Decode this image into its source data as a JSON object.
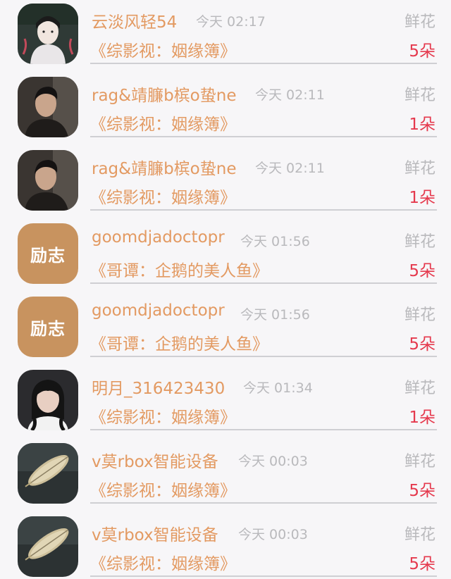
{
  "accent_colors": {
    "username": "#e39a62",
    "count": "#e5394d",
    "muted": "#b9b9bc",
    "divider": "#cfcfd3"
  },
  "records": [
    {
      "avatar": "avatar-illustrated-character-icon",
      "username": "云淡风轻54",
      "time": "今天 02:17",
      "gift_label": "鲜花",
      "book_title": "《综影视：姻缘簿》",
      "count": "5朵"
    },
    {
      "avatar": "avatar-young-man-photo-icon",
      "username": "rag&靖臁b槟o蛰ne",
      "time": "今天 02:11",
      "gift_label": "鲜花",
      "book_title": "《综影视：姻缘簿》",
      "count": "1朵"
    },
    {
      "avatar": "avatar-young-man-photo-icon",
      "username": "rag&靖臁b槟o蛰ne",
      "time": "今天 02:11",
      "gift_label": "鲜花",
      "book_title": "《综影视：姻缘簿》",
      "count": "1朵"
    },
    {
      "avatar": "avatar-lizhi-text-icon",
      "avatar_text": "励志",
      "username": "goomdjadoctopr",
      "time": "今天 01:56",
      "gift_label": "鲜花",
      "book_title": "《哥谭：企鹅的美人鱼》",
      "count": "5朵"
    },
    {
      "avatar": "avatar-lizhi-text-icon",
      "avatar_text": "励志",
      "username": "goomdjadoctopr",
      "time": "今天 01:56",
      "gift_label": "鲜花",
      "book_title": "《哥谭：企鹅的美人鱼》",
      "count": "5朵"
    },
    {
      "avatar": "avatar-girl-photo-icon",
      "username": "明月_316423430",
      "time": "今天 01:34",
      "gift_label": "鲜花",
      "book_title": "《综影视：姻缘簿》",
      "count": "1朵"
    },
    {
      "avatar": "avatar-golden-leaf-icon",
      "username": "v莫rbox智能设备",
      "time": "今天 00:03",
      "gift_label": "鲜花",
      "book_title": "《综影视：姻缘簿》",
      "count": "5朵"
    },
    {
      "avatar": "avatar-golden-leaf-icon",
      "username": "v莫rbox智能设备",
      "time": "今天 00:03",
      "gift_label": "鲜花",
      "book_title": "《综影视：姻缘簿》",
      "count": "5朵"
    }
  ]
}
